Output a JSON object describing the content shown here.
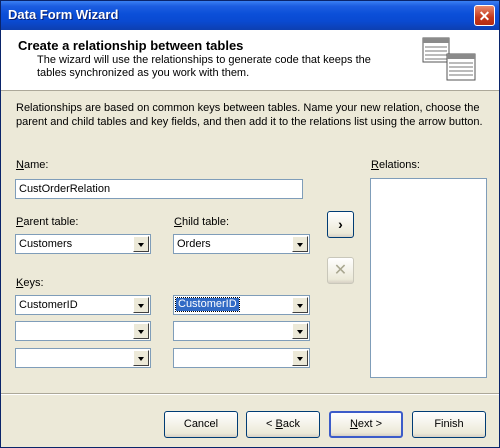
{
  "window": {
    "title": "Data Form Wizard"
  },
  "header": {
    "title": "Create a relationship between tables",
    "description": "The wizard will use the relationships to generate code that keeps the tables synchronized as you work with them."
  },
  "intro": "Relationships are based on common keys between tables. Name your new relation, choose the parent and child tables and key fields, and then add it to the relations list using the arrow button.",
  "name": {
    "label_mnemonic": "N",
    "label_rest": "ame:",
    "value": "CustOrderRelation"
  },
  "parent_table": {
    "label_mnemonic": "P",
    "label_rest": "arent table:",
    "value": "Customers"
  },
  "child_table": {
    "label_mnemonic": "C",
    "label_rest": "hild table:",
    "value": "Orders"
  },
  "keys": {
    "label_mnemonic": "K",
    "label_rest": "eys:",
    "rows": [
      {
        "parent": "CustomerID",
        "child": "CustomerID"
      },
      {
        "parent": "",
        "child": ""
      },
      {
        "parent": "",
        "child": ""
      }
    ]
  },
  "relations": {
    "label_mnemonic": "R",
    "label_rest": "elations:",
    "items": []
  },
  "side_buttons": {
    "add": "›",
    "remove": "✕"
  },
  "buttons": {
    "cancel": "Cancel",
    "back_prefix": "< ",
    "back_mnemonic": "B",
    "back_rest": "ack",
    "next_mnemonic": "N",
    "next_rest": "ext >",
    "finish": "Finish"
  },
  "colors": {
    "title_bar": "#0a4ad1",
    "selection": "#316ac5",
    "dialog_bg": "#ece9d8"
  }
}
